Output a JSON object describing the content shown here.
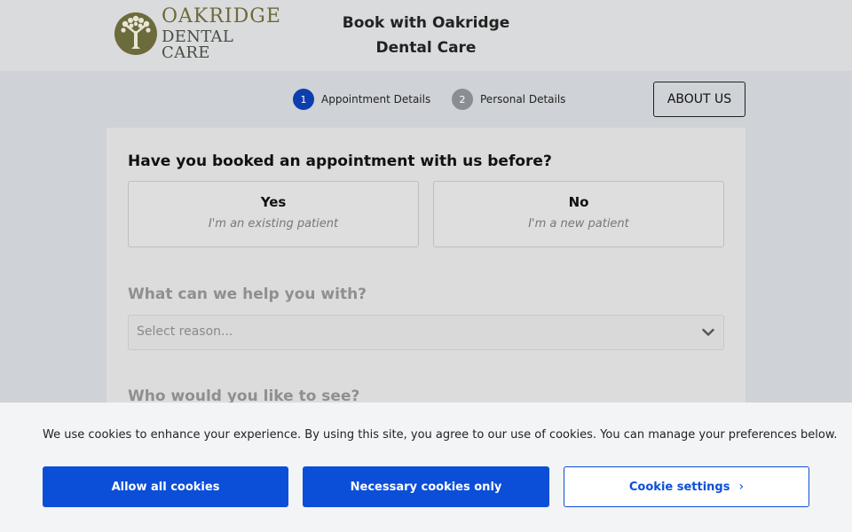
{
  "header": {
    "logo": {
      "line1": "OAKRIDGE",
      "line2": "DENTAL CARE"
    },
    "title": "Book with Oakridge Dental Care"
  },
  "steps": [
    {
      "number": "1",
      "label": "Appointment Details",
      "active": true
    },
    {
      "number": "2",
      "label": "Personal Details",
      "active": false
    }
  ],
  "nav": {
    "about_label": "ABOUT US"
  },
  "form": {
    "question1": "Have you booked an appointment with us before?",
    "choices": [
      {
        "title": "Yes",
        "subtitle": "I'm an existing patient"
      },
      {
        "title": "No",
        "subtitle": "I'm a new patient"
      }
    ],
    "question2": "What can we help you with?",
    "reason_placeholder": "Select reason...",
    "question3": "Who would you like to see?"
  },
  "cookie": {
    "message": "We use cookies to enhance your experience. By using this site, you agree to our use of cookies. You can manage your preferences below.",
    "allow_all_label": "Allow all cookies",
    "necessary_label": "Necessary cookies only",
    "settings_label": "Cookie settings"
  },
  "colors": {
    "accent": "#0b4fd8",
    "step_active": "#0b3fb0",
    "step_inactive": "#8a8d93",
    "logo_olive": "#6b6b3c"
  },
  "icons": {
    "logo": "tree-icon",
    "select_chevron": "chevron-down-icon",
    "cookie_settings_chevron": "chevron-right-icon"
  }
}
